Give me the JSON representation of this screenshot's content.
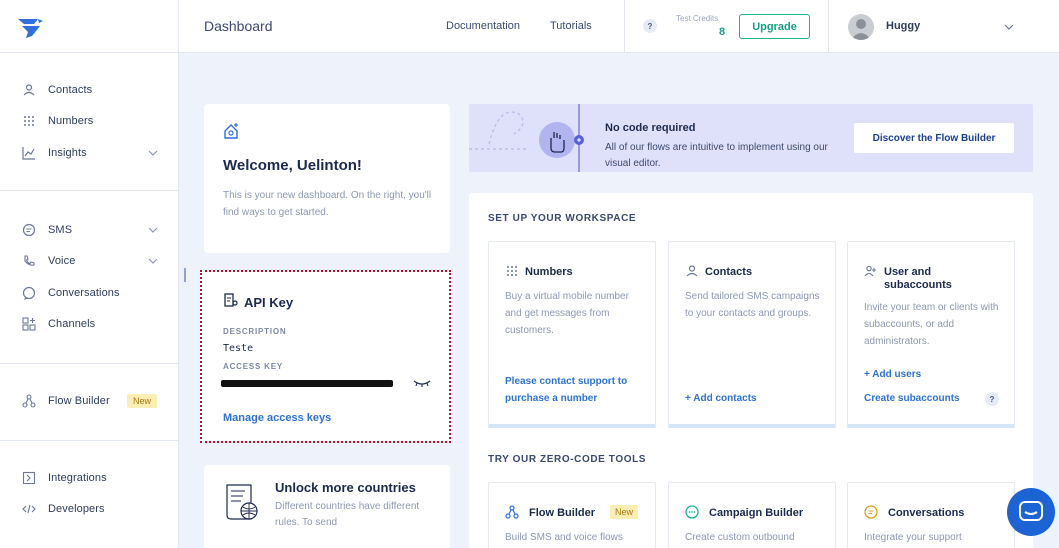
{
  "sidebar": {
    "items": [
      {
        "label": "Contacts"
      },
      {
        "label": "Numbers"
      },
      {
        "label": "Insights"
      },
      {
        "label": "SMS"
      },
      {
        "label": "Voice"
      },
      {
        "label": "Conversations"
      },
      {
        "label": "Channels"
      },
      {
        "label": "Flow Builder",
        "badge": "New"
      },
      {
        "label": "Integrations"
      },
      {
        "label": "Developers"
      }
    ]
  },
  "header": {
    "title": "Dashboard",
    "documentation": "Documentation",
    "tutorials": "Tutorials",
    "help": "?",
    "credits_label": "Test Credits",
    "credits_value": "8",
    "upgrade": "Upgrade",
    "user_name": "Huggy"
  },
  "welcome": {
    "title": "Welcome, Uelinton!",
    "description": "This is your new dashboard. On the right, you'll find ways to get started."
  },
  "api_key": {
    "title": "API Key",
    "description_label": "DESCRIPTION",
    "description_value": "Teste",
    "access_key_label": "ACCESS KEY",
    "manage_link": "Manage access keys"
  },
  "unlock": {
    "title": "Unlock more countries",
    "description": "Different countries have different rules. To send"
  },
  "banner": {
    "title": "No code required",
    "description": "All of our flows are intuitive to implement using our visual editor.",
    "button": "Discover the Flow Builder"
  },
  "workspace": {
    "header": "SET UP YOUR WORKSPACE",
    "tiles": [
      {
        "title": "Numbers",
        "description": "Buy a virtual mobile number and get messages from customers.",
        "link": "Please contact support to purchase a number"
      },
      {
        "title": "Contacts",
        "description": "Send tailored SMS campaigns to your contacts and groups.",
        "link": "+ Add contacts"
      },
      {
        "title": "User and subaccounts",
        "description": "Invite your team or clients with subaccounts, or add administrators.",
        "link1": "+ Add users",
        "link2": "Create subaccounts",
        "help": "?"
      }
    ]
  },
  "tools": {
    "header": "TRY OUR ZERO-CODE TOOLS",
    "tiles": [
      {
        "title": "Flow Builder",
        "badge": "New",
        "description": "Build SMS and voice flows"
      },
      {
        "title": "Campaign Builder",
        "description": "Create custom outbound"
      },
      {
        "title": "Conversations",
        "description": "Integrate your support"
      }
    ]
  },
  "colors": {
    "accent_green": "#1bb394",
    "link_blue": "#2f73d1",
    "banner_bg": "#dfe1fb",
    "highlight_border": "#b3122e"
  }
}
